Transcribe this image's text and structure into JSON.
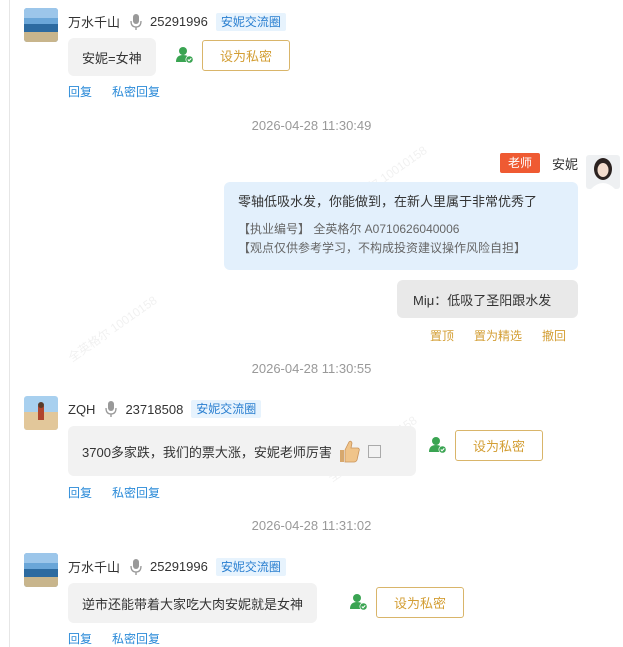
{
  "messages": [
    {
      "user": "万水千山",
      "uid": "25291996",
      "group": "安妮交流圈",
      "text": "安妮=女神",
      "action_button": "设为私密",
      "links": [
        "回复",
        "私密回复"
      ]
    },
    {
      "user": "ZQH",
      "uid": "23718508",
      "group": "安妮交流圈",
      "text": "3700多家跌，我们的票大涨，安妮老师厉害",
      "action_button": "设为私密",
      "links": [
        "回复",
        "私密回复"
      ]
    },
    {
      "user": "万水千山",
      "uid": "25291996",
      "group": "安妮交流圈",
      "text": "逆市还能带着大家吃大肉安妮就是女神",
      "action_button": "设为私密",
      "links": [
        "回复",
        "私密回复"
      ]
    }
  ],
  "timestamps": [
    "2026-04-28 11:30:49",
    "2026-04-28 11:30:55",
    "2026-04-28 11:31:02"
  ],
  "teacher": {
    "role": "老师",
    "name": "安妮",
    "message": "零轴低吸水发，你能做到，在新人里属于非常优秀了",
    "license": "【执业编号】 全英格尔 A0710626040006",
    "disclaimer": "【观点仅供参考学习，不构成投资建议操作风险自担】",
    "quoted_reply": "Miμ：低吸了圣阳跟水发",
    "actions": [
      "置顶",
      "置为精选",
      "撤回"
    ]
  },
  "colors": {
    "link_blue": "#2a8ad8",
    "gold": "#d39e34",
    "badge_red": "#ef5a32",
    "teacher_bubble": "#e3f0fc"
  },
  "icons": [
    "mic-icon",
    "user-check-icon",
    "thumbs-up-emoji",
    "copy-icon"
  ]
}
